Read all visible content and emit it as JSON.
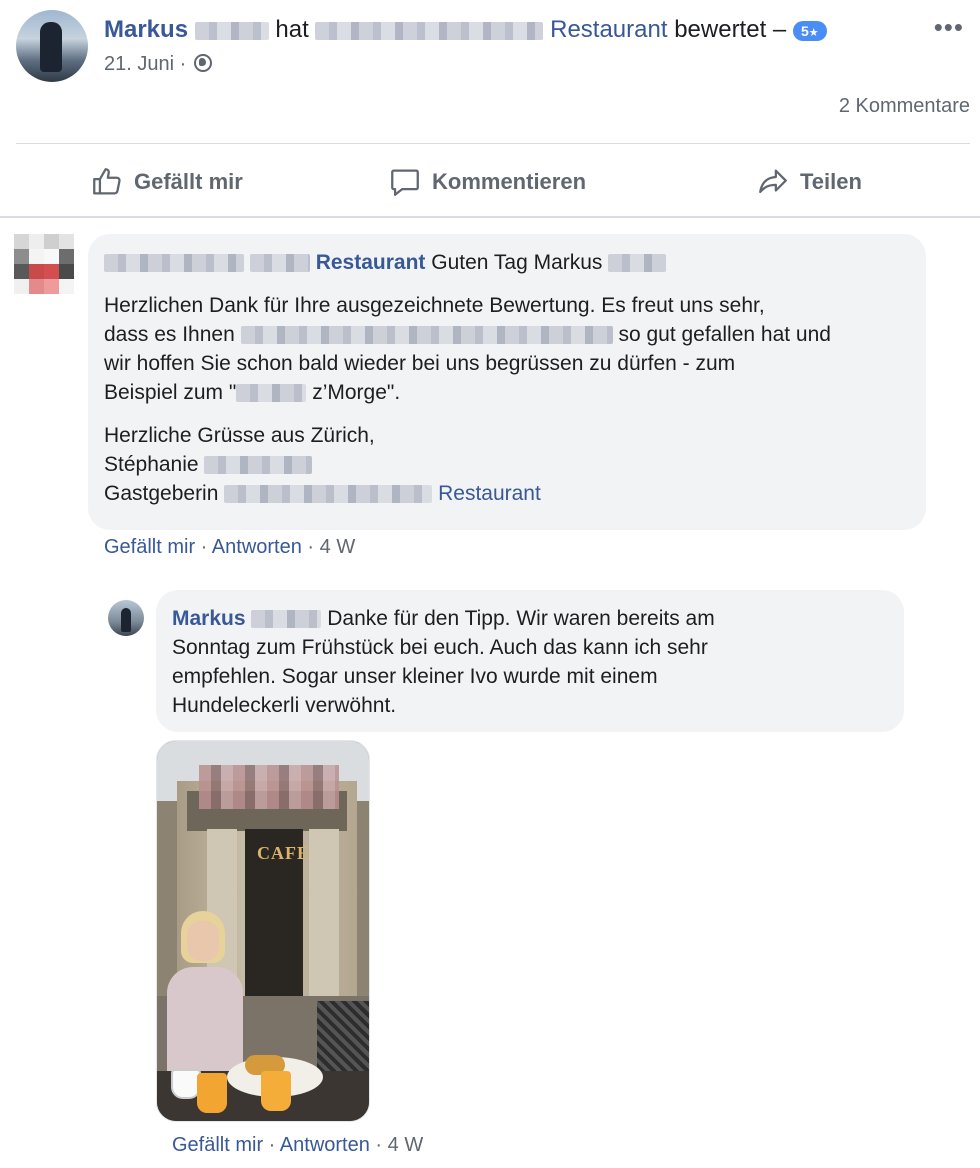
{
  "post": {
    "author": "Markus",
    "verb": "hat",
    "page_suffix": "Restaurant",
    "action_text": "bewertet –",
    "rating_value": "5",
    "rating_star": "★",
    "date": "21. Juni ·",
    "more": "•••",
    "comment_count": "2 Kommentare"
  },
  "actions": {
    "like": "Gefällt mir",
    "comment": "Kommentieren",
    "share": "Teilen"
  },
  "comment1": {
    "page_suffix": "Restaurant",
    "greeting": "Guten Tag Markus",
    "p1_a": "Herzlichen Dank für Ihre ausgezeichnete Bewertung. Es freut uns sehr,",
    "p1_b": "dass es Ihnen",
    "p1_c": "so gut gefallen hat und",
    "p1_d": "wir hoffen Sie schon bald wieder bei uns begrüssen zu dürfen - zum",
    "p1_e": "Beispiel zum \"",
    "p1_f": "z’Morge\".",
    "p2_a": "Herzliche Grüsse aus Zürich,",
    "p2_b": "Stéphanie",
    "p2_c": "Gastgeberin",
    "p2_link": "Restaurant",
    "meta_like": "Gefällt mir",
    "meta_dot1": " · ",
    "meta_reply": "Antworten",
    "meta_time": " · 4 W"
  },
  "comment2": {
    "author": "Markus",
    "line1": "Danke für den Tipp. Wir waren bereits am",
    "line2": "Sonntag zum Frühstück bei euch. Auch das kann ich sehr",
    "line3": "empfehlen. Sogar unser kleiner Ivo wurde mit einem",
    "line4": "Hundeleckerli verwöhnt.",
    "photo_sign": "CAFE",
    "meta_like": "Gefällt mir",
    "meta_dot1": " · ",
    "meta_reply": "Antworten",
    "meta_time": " · 4 W"
  },
  "colors": {
    "link": "#385898",
    "muted": "#606770",
    "bubble": "#f2f3f5",
    "rating_badge": "#4a8ef5"
  },
  "icons": [
    "globe-icon",
    "more-icon",
    "thumbs-up-icon",
    "comment-icon",
    "share-icon"
  ]
}
